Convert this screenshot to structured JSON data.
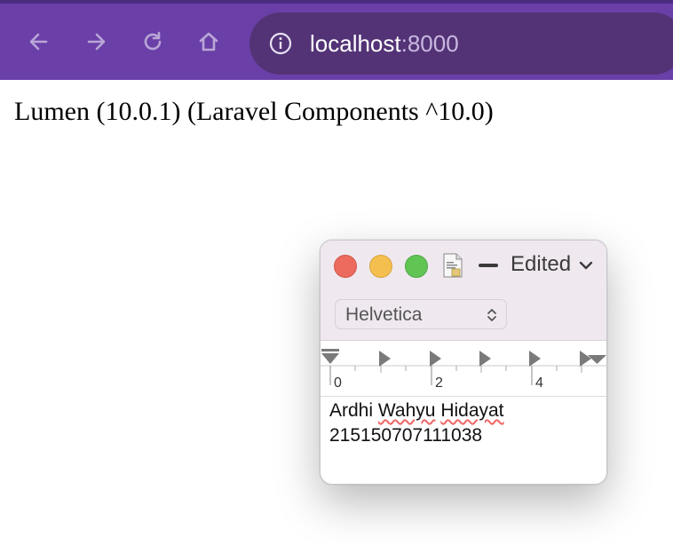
{
  "browser": {
    "url_host": "localhost",
    "url_port": ":8000",
    "colors": {
      "toolbar": "#6a3fa8",
      "omnibox": "#533376"
    }
  },
  "page": {
    "text": "Lumen (10.0.1) (Laravel Components ^10.0)"
  },
  "textedit": {
    "title": "Edited",
    "font": "Helvetica",
    "ruler_labels": [
      "0",
      "2",
      "4"
    ],
    "words_line1": [
      "Ardhi",
      "Wahyu",
      "Hidayat"
    ],
    "line2": "215150707111038"
  }
}
